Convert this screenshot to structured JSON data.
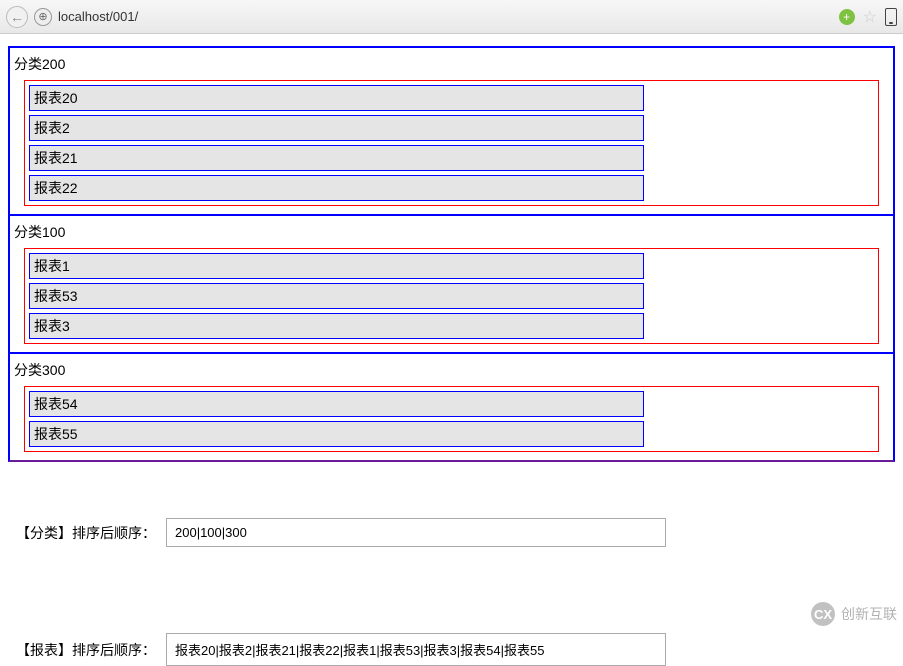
{
  "browser": {
    "url": "localhost/001/"
  },
  "categories": [
    {
      "name": "分类200",
      "reports": [
        "报表20",
        "报表2",
        "报表21",
        "报表22"
      ]
    },
    {
      "name": "分类100",
      "reports": [
        "报表1",
        "报表53",
        "报表3"
      ]
    },
    {
      "name": "分类300",
      "reports": [
        "报表54",
        "报表55"
      ]
    }
  ],
  "summary_cat": {
    "label": "【分类】排序后顺序：",
    "value": "200|100|300"
  },
  "summary_rep": {
    "label": "【报表】排序后顺序：",
    "value": "报表20|报表2|报表21|报表22|报表1|报表53|报表3|报表54|报表55"
  },
  "watermark": "创新互联"
}
